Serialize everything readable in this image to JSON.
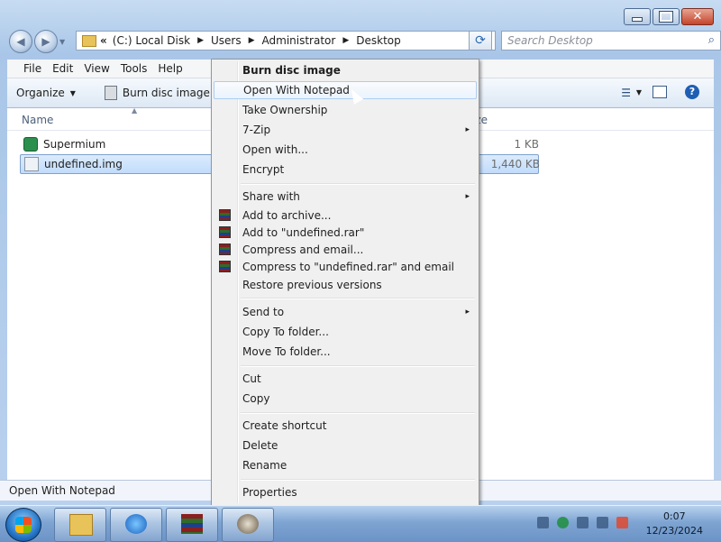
{
  "window": {
    "address": {
      "chevron": "«",
      "crumbs": [
        "(C:) Local Disk",
        "Users",
        "Administrator",
        "Desktop"
      ]
    },
    "search_placeholder": "Search Desktop",
    "menu": [
      "File",
      "Edit",
      "View",
      "Tools",
      "Help"
    ],
    "toolbar": {
      "organize": "Organize",
      "burn": "Burn disc image"
    },
    "columns": {
      "name": "Name",
      "size": "ize"
    },
    "files": [
      {
        "name": "Supermium",
        "size": "1 KB",
        "icon": "shortcut-icon"
      },
      {
        "name": "undefined.img",
        "size": "1,440 KB",
        "icon": "disc-image-icon",
        "selected": true
      }
    ],
    "status": "Open With Notepad"
  },
  "context_menu": {
    "items": [
      {
        "label": "Burn disc image",
        "bold": true
      },
      {
        "label": "Open With Notepad",
        "highlighted": true
      },
      {
        "label": "Take Ownership"
      },
      {
        "label": "7-Zip",
        "submenu": true
      },
      {
        "label": "Open with..."
      },
      {
        "label": "Encrypt"
      },
      {
        "label": "Share with",
        "submenu": true
      },
      {
        "label": "Add to archive...",
        "icon": "winrar-icon"
      },
      {
        "label": "Add to \"undefined.rar\"",
        "icon": "winrar-icon"
      },
      {
        "label": "Compress and email...",
        "icon": "winrar-icon"
      },
      {
        "label": "Compress to \"undefined.rar\" and email",
        "icon": "winrar-icon"
      },
      {
        "label": "Restore previous versions"
      },
      {
        "label": "Send to",
        "submenu": true
      },
      {
        "label": "Copy To folder..."
      },
      {
        "label": "Move To folder..."
      },
      {
        "label": "Cut"
      },
      {
        "label": "Copy"
      },
      {
        "label": "Create shortcut"
      },
      {
        "label": "Delete"
      },
      {
        "label": "Rename"
      },
      {
        "label": "Properties"
      }
    ],
    "submenu_arrow": "▸"
  },
  "taskbar": {
    "apps": [
      "explorer-icon",
      "internet-explorer-icon",
      "winrar-icon",
      "app-icon"
    ],
    "clock": {
      "time": "0:07",
      "date": "12/23/2024"
    }
  }
}
